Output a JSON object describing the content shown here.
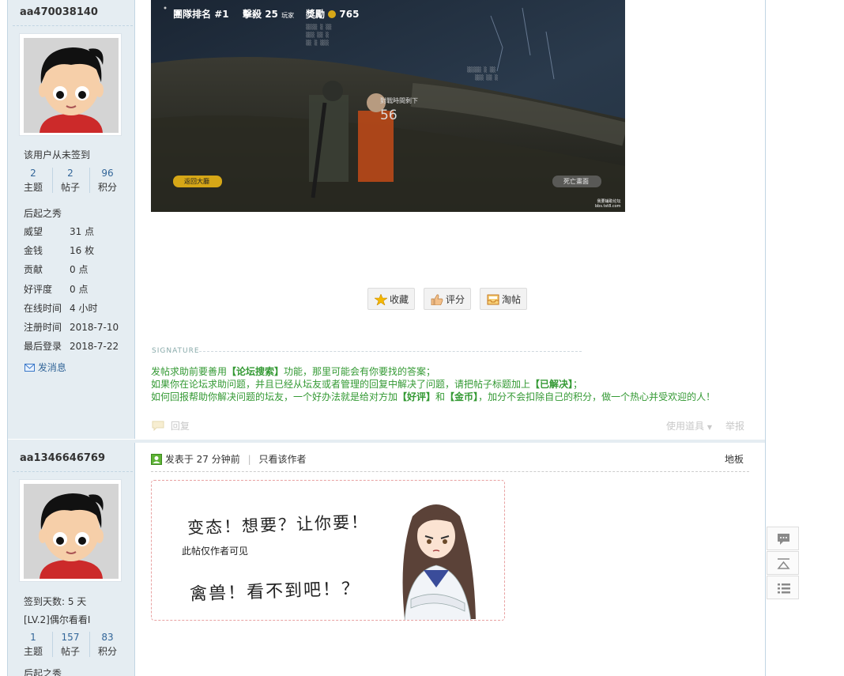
{
  "post1": {
    "username": "aa470038140",
    "checkin_status": "该用户从未签到",
    "stats": [
      {
        "value": "2",
        "label": "主题"
      },
      {
        "value": "2",
        "label": "帖子"
      },
      {
        "value": "96",
        "label": "积分"
      }
    ],
    "rank": "后起之秀",
    "info": [
      {
        "key": "威望",
        "value": "31 点"
      },
      {
        "key": "金钱",
        "value": "16 枚"
      },
      {
        "key": "贡献",
        "value": "0 点"
      },
      {
        "key": "好评度",
        "value": "0 点"
      },
      {
        "key": "在线时间",
        "value": "4 小时"
      },
      {
        "key": "注册时间",
        "value": "2018-7-10"
      },
      {
        "key": "最后登录",
        "value": "2018-7-22"
      }
    ],
    "message_link": "发消息",
    "game_hud": {
      "team_rank_label": "團隊排名",
      "team_rank_value": "#1",
      "kills_label": "擊殺",
      "kills_value": "25",
      "kills_unit": "玩家",
      "reward_label": "獎勵",
      "reward_value": "765",
      "player_count_label": "對戰時間剩下",
      "player_count": "56",
      "return_button": "返回大廳",
      "death_button": "死亡畫面",
      "watermark_line1": "我要辅助论坛",
      "watermark_line2": "bbs.tst8.com"
    },
    "actions": [
      {
        "label": "收藏",
        "icon": "star-icon"
      },
      {
        "label": "评分",
        "icon": "thumbs-up-icon"
      },
      {
        "label": "淘帖",
        "icon": "tray-icon"
      }
    ],
    "signature_title": "SIGNATURE",
    "signature_lines": [
      [
        {
          "t": "发帖求助前要善用"
        },
        {
          "t": "【论坛搜索】",
          "b": true
        },
        {
          "t": "功能，那里可能会有你要找的答案；"
        }
      ],
      [
        {
          "t": "如果你在论坛求助问题，并且已经从坛友或者管理的回复中解决了问题，请把帖子标题加上"
        },
        {
          "t": "【已解决】",
          "b": true
        },
        {
          "t": "；"
        }
      ],
      [
        {
          "t": "如何回报帮助你解决问题的坛友，一个好办法就是给对方加"
        },
        {
          "t": "【好评】",
          "b": true
        },
        {
          "t": "和"
        },
        {
          "t": "【金币】",
          "b": true
        },
        {
          "t": "，加分不会扣除自己的积分，做一个热心并受欢迎的人！"
        }
      ]
    ],
    "reply_label": "回复",
    "use_tool_label": "使用道具",
    "report_label": "举报"
  },
  "post2": {
    "username": "aa1346646769",
    "checkin_days": "签到天数: 5 天",
    "level": "[LV.2]偶尔看看I",
    "stats": [
      {
        "value": "1",
        "label": "主题"
      },
      {
        "value": "157",
        "label": "帖子"
      },
      {
        "value": "83",
        "label": "积分"
      }
    ],
    "rank_partial": "后起之秀",
    "posted_time": "发表于 27 分钟前",
    "only_author": "只看该作者",
    "floor_label": "地板",
    "hidden_notice": "此帖仅作者可见",
    "hidden_image_text1": "变态！想要？让你要！",
    "hidden_image_text2": "禽兽！看不到吧！？"
  },
  "side_tools": [
    {
      "icon": "comment-icon"
    },
    {
      "icon": "back-to-top-icon"
    },
    {
      "icon": "list-icon"
    }
  ]
}
